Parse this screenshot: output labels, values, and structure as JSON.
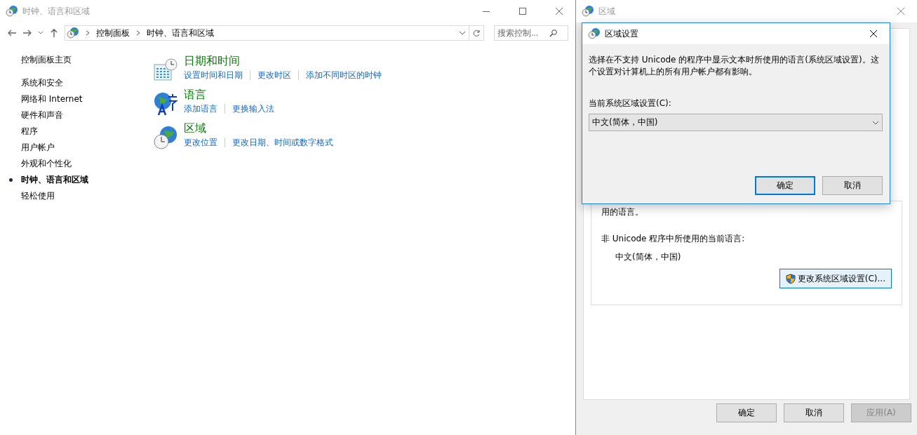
{
  "main_window": {
    "title": "时钟、语言和区域",
    "breadcrumb": [
      "控制面板",
      "时钟、语言和区域"
    ],
    "search": {
      "placeholder": "搜索控制..."
    },
    "sidebar": {
      "home": "控制面板主页",
      "items": [
        {
          "label": "系统和安全",
          "selected": false
        },
        {
          "label": "网络和 Internet",
          "selected": false
        },
        {
          "label": "硬件和声音",
          "selected": false
        },
        {
          "label": "程序",
          "selected": false
        },
        {
          "label": "用户帐户",
          "selected": false
        },
        {
          "label": "外观和个性化",
          "selected": false
        },
        {
          "label": "时钟、语言和区域",
          "selected": true
        },
        {
          "label": "轻松使用",
          "selected": false
        }
      ]
    },
    "categories": [
      {
        "kind": "datetime",
        "title": "日期和时间",
        "links": [
          "设置时间和日期",
          "更改时区",
          "添加不同时区的时钟"
        ]
      },
      {
        "kind": "language",
        "title": "语言",
        "links": [
          "添加语言",
          "更换输入法"
        ]
      },
      {
        "kind": "region",
        "title": "区域",
        "links": [
          "更改位置",
          "更改日期、时间或数字格式"
        ]
      }
    ]
  },
  "region_window": {
    "title": "区域",
    "partial_text": "用的语言。",
    "label": "非 Unicode 程序中所使用的当前语言:",
    "current_language": "中文(简体，中国)",
    "change_button": "更改系统区域设置(C)...",
    "buttons": [
      {
        "label": "确定",
        "disabled": false
      },
      {
        "label": "取消",
        "disabled": false
      },
      {
        "label": "应用(A)",
        "disabled": true
      }
    ]
  },
  "dialog": {
    "title": "区域设置",
    "description": "选择在不支持 Unicode 的程序中显示文本时所使用的语言(系统区域设置)。这个设置对计算机上的所有用户帐户都有影响。",
    "label": "当前系统区域设置(C):",
    "value": "中文(简体，中国)",
    "buttons": [
      {
        "label": "确定",
        "default": true
      },
      {
        "label": "取消",
        "default": false
      }
    ]
  }
}
